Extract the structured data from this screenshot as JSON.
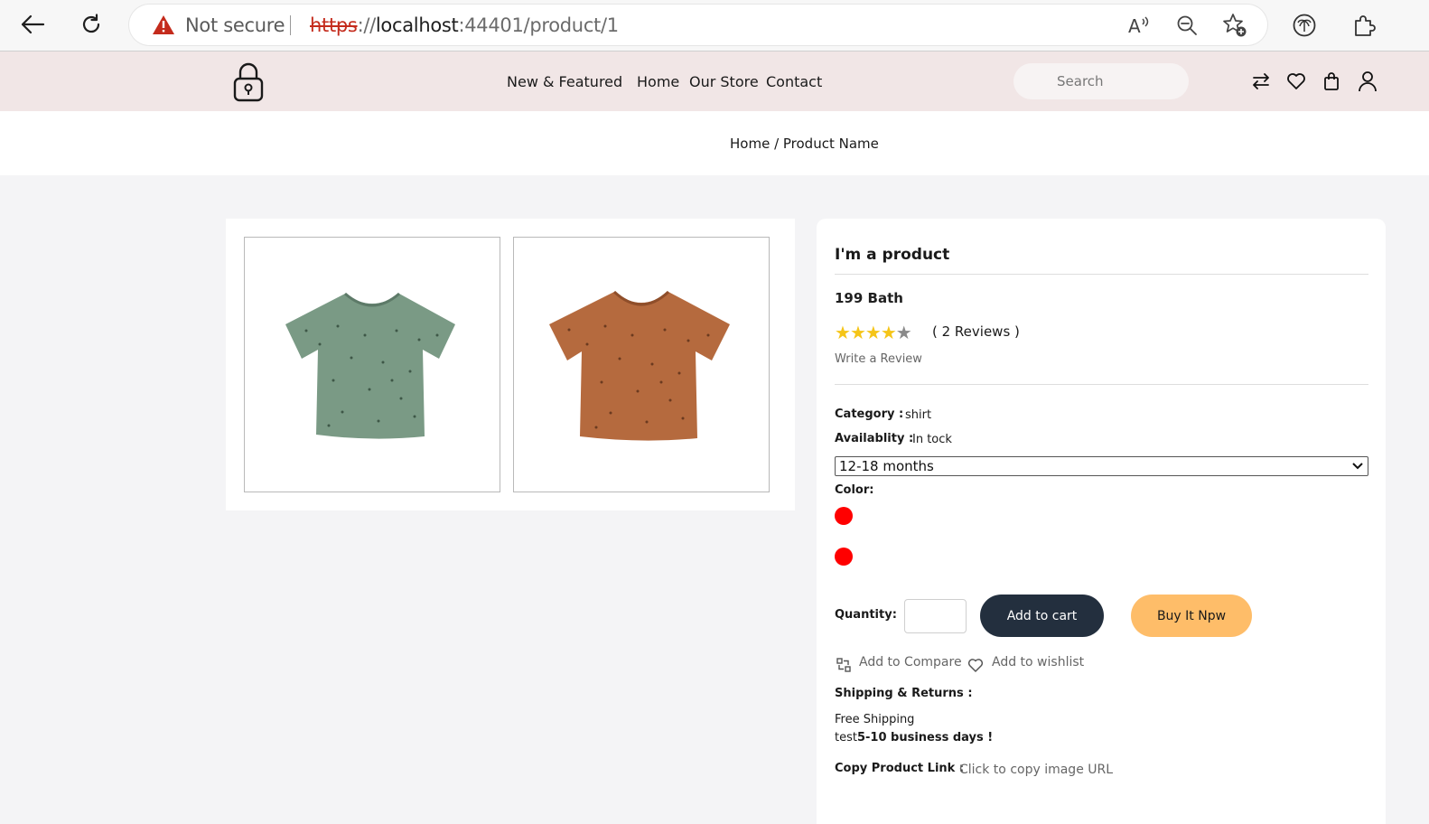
{
  "browser": {
    "security_label": "Not secure",
    "url_protocol": "https",
    "url_separator": "://",
    "url_host": "localhost",
    "url_rest": ":44401/product/1"
  },
  "header": {
    "nav": [
      "New & Featured",
      "Home",
      "Our Store",
      "Contact"
    ],
    "search_placeholder": "Search"
  },
  "breadcrumb": {
    "home": "Home",
    "separator": " / ",
    "current": "Product Name"
  },
  "product": {
    "title": "I'm a product",
    "price": "199 Bath",
    "rating": 4,
    "rating_max": 5,
    "reviews": "( 2 Reviews )",
    "write_review": "Write a Review",
    "category_label": "Category :",
    "category_value": "shirt",
    "availability_label": "Availablity :",
    "availability_value": "In tock",
    "size_selected": "12-18 months",
    "color_label": "Color:",
    "colors": [
      "#ff0000",
      "#ff0000"
    ],
    "quantity_label": "Quantity:",
    "add_to_cart": "Add to cart",
    "buy_now": "Buy It Npw",
    "add_to_compare": "Add to Compare",
    "add_to_wishlist": "Add to wishlist",
    "shipping_label": "Shipping & Returns :",
    "shipping_line1": "Free Shipping",
    "shipping_line2_prefix": "test",
    "shipping_line2_bold": "5-10 business days !",
    "copy_label": "Copy Product Link :",
    "copy_action": "Click to copy image URL",
    "image_colors": [
      "#7a9a85",
      "#b56a3e"
    ]
  }
}
